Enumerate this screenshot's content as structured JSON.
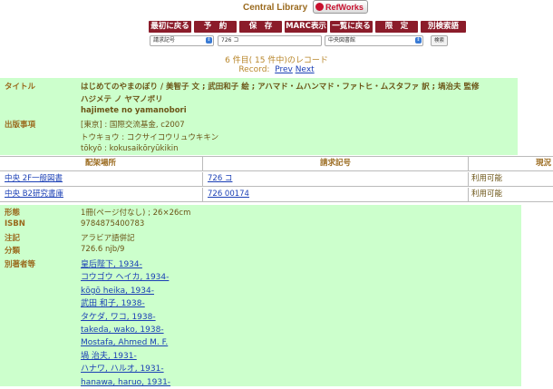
{
  "header": {
    "title": "Central Library",
    "refworks": "RefWorks"
  },
  "toolbar": {
    "buttons": [
      "最初に戻る",
      "予　約",
      "保　存",
      "MARC表示",
      "一覧に戻る",
      "限　定",
      "別検索語"
    ]
  },
  "search": {
    "field": "請求記号",
    "query": "726 コ",
    "library": "中央図書館",
    "go": "検索"
  },
  "record_info": {
    "count": "6 件目( 15 件中)のレコード",
    "label": "Record:",
    "prev": "Prev",
    "next": "Next"
  },
  "bib": {
    "title_label": "タイトル",
    "title": "はじめてのやまのぼり / 美智子 文 ; 武田和子 絵 ; アハマド・ムハンマド・ファトヒ・ムスタファ 訳 ; 堝治夫 監修",
    "title_kana": "ハジメテ ノ ヤマノボリ",
    "title_romaji": "hajimete no yamanobori",
    "pub_label": "出版事項",
    "pub": "[東京] : 国際交流基金, c2007",
    "pub_kana": "トウキョウ : コクサイコウリュウキキン",
    "pub_romaji": "tōkyō : kokusaikōryūkikin"
  },
  "holdings": {
    "headers": {
      "location": "配架場所",
      "callno": "請求記号",
      "status": "現況"
    },
    "rows": [
      {
        "location": "中央 2F一般図書",
        "callno": "726 コ",
        "status": "利用可能"
      },
      {
        "location": "中央 B2研究書庫",
        "callno": "726 00174",
        "status": "利用可能"
      }
    ]
  },
  "details": {
    "format_label": "形態",
    "format": "1冊(ページ付なし) ; 26×26cm",
    "isbn_label": "ISBN",
    "isbn": "9784875400783",
    "note_label": "注記",
    "note": "アラビア語併記",
    "class_label": "分類",
    "class": "726.6 njb/9",
    "authors_label": "別著者等",
    "authors": [
      "皇后陛下, 1934-",
      "コウゴウ ヘイカ, 1934-",
      "kōgō heika, 1934-",
      "武田 和子, 1938-",
      "タケダ, ワコ, 1938-",
      "takeda, wako, 1938-",
      "Mostafa, Ahmed M. F.",
      "堝 治夫, 1931-",
      "ハナワ, ハルオ, 1931-",
      "hanawa, haruo, 1931-"
    ]
  }
}
